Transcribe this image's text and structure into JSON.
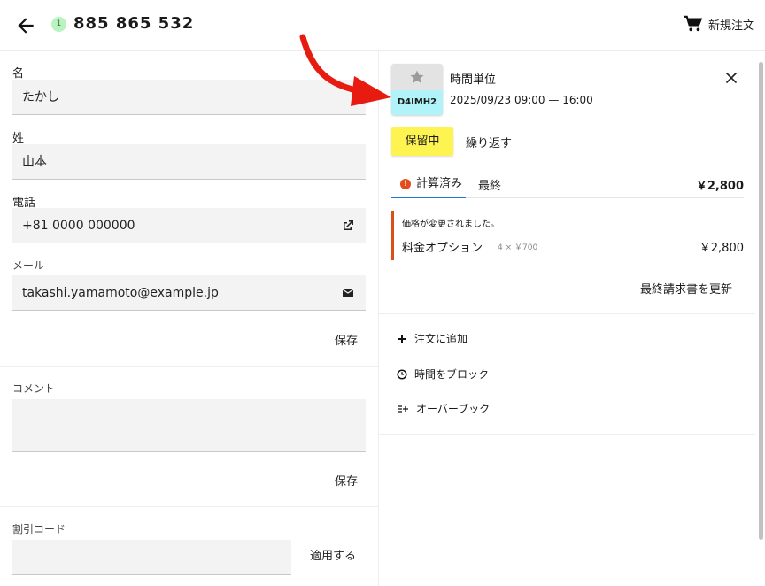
{
  "header": {
    "badge_count": "1",
    "title": "885 865 532",
    "new_order_label": "新規注文",
    "back_icon": "arrow-left-icon",
    "cart_icon": "cart-icon"
  },
  "customer": {
    "first_name_label": "名",
    "first_name_value": "たかし",
    "last_name_label": "姓",
    "last_name_value": "山本",
    "phone_label": "電話",
    "phone_value": "+81 0000 000000",
    "email_label": "メール",
    "email_value": "takashi.yamamoto@example.jp",
    "save_label": "保存"
  },
  "comment": {
    "label": "コメント",
    "value": "",
    "save_label": "保存"
  },
  "discount": {
    "label": "割引コード",
    "value": "",
    "apply_label": "適用する"
  },
  "booking": {
    "service_name": "時間単位",
    "code": "D4IMH2",
    "datetime": "2025/09/23 09:00 — 16:00",
    "status_label": "保留中",
    "status_color": "#fdf452",
    "repeat_label": "繰り返す",
    "tabs": [
      {
        "label": "計算済み",
        "active": true,
        "icon": "warning-icon"
      },
      {
        "label": "最終",
        "active": false
      }
    ],
    "total": "￥2,800",
    "notice": "価格が変更されました。",
    "option_name": "料金オプション",
    "option_qty": "4 × ￥700",
    "option_price": "￥2,800",
    "update_invoice_label": "最終請求書を更新"
  },
  "actions": [
    {
      "label": "注文に追加",
      "icon": "plus-icon"
    },
    {
      "label": "時間をブロック",
      "icon": "clock-icon"
    },
    {
      "label": "オーバーブック",
      "icon": "overbook-icon"
    }
  ],
  "colors": {
    "accent_blue": "#1d79d0",
    "warning": "#e34c1b",
    "code_bg": "#b0f4f9",
    "annotation_arrow": "#e81b10"
  }
}
